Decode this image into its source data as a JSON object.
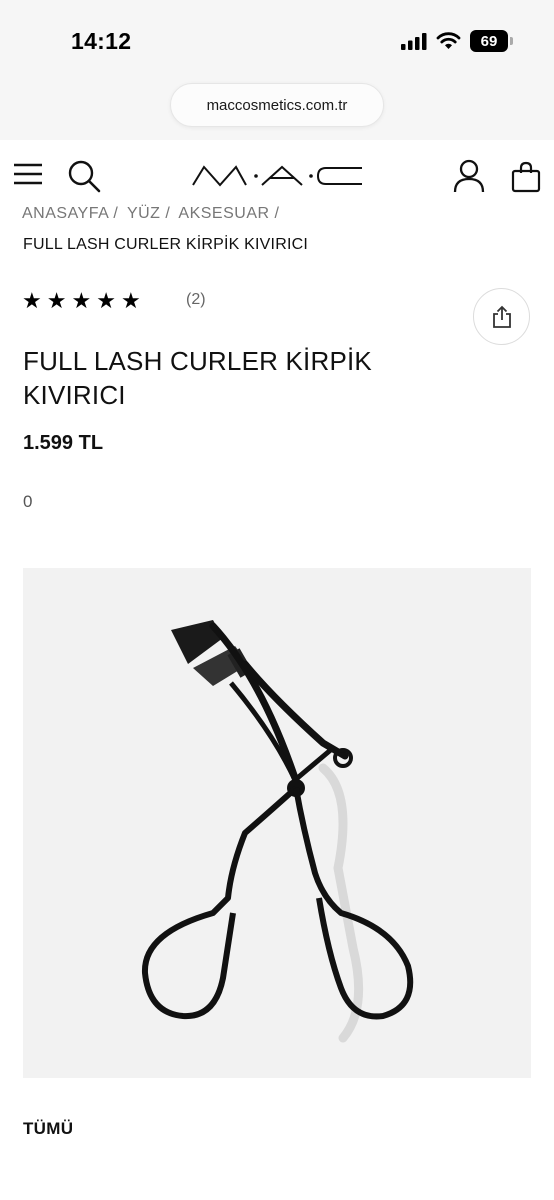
{
  "status_bar": {
    "time": "14:12",
    "battery": "69"
  },
  "browser": {
    "url": "maccosmetics.com.tr"
  },
  "header": {
    "logo_text": "M·A·C",
    "icons": [
      "menu-icon",
      "search-icon",
      "account-icon",
      "shopping-bag-icon"
    ]
  },
  "breadcrumb": {
    "items": [
      "ANASAYFA /",
      "YÜZ /",
      "AKSESUAR /"
    ],
    "current": "FULL LASH CURLER KİRPİK KIVIRICI"
  },
  "rating": {
    "stars": 5,
    "stars_glyph": "★",
    "review_count": "(2)"
  },
  "product": {
    "title": "FULL LASH CURLER KİRPİK KIVIRICI",
    "price": "1.599 TL",
    "secondary_value": "0",
    "image_alt": "eyelash-curler"
  },
  "filters": {
    "all_label": "TÜMÜ"
  },
  "colors": {
    "text": "#111111",
    "muted": "#777777",
    "image_bg": "#f2f2f2",
    "topbar_bg": "#f6f6f6"
  }
}
